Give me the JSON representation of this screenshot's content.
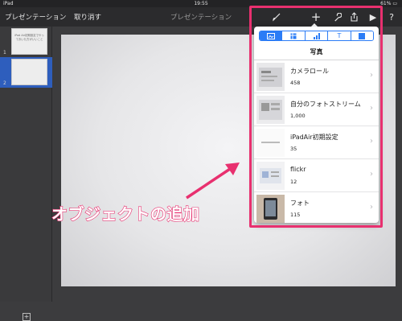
{
  "status_bar": {
    "carrier": "iPad",
    "time": "19:55",
    "battery": "61%"
  },
  "nav": {
    "presentations": "プレゼンテーション",
    "undo": "取り消す",
    "title": "プレゼンテーション"
  },
  "toolbar_icons": [
    "paintbrush-icon",
    "plus-icon",
    "wrench-icon",
    "share-icon",
    "play-icon",
    "help-icon"
  ],
  "slides": [
    {
      "number": "1",
      "text": "iPad Air初期設定でやっておいた方がいいこと"
    },
    {
      "number": "2",
      "text": ""
    }
  ],
  "popover": {
    "tabs": [
      "media",
      "table",
      "chart",
      "text",
      "shape"
    ],
    "active_tab": "media",
    "title": "写真",
    "albums": [
      {
        "name": "カメラロール",
        "count": "458"
      },
      {
        "name": "自分のフォトストリーム",
        "count": "1,000"
      },
      {
        "name": "iPadAir初期設定",
        "count": "35"
      },
      {
        "name": "flickr",
        "count": "12"
      },
      {
        "name": "フォト",
        "count": "115"
      }
    ]
  },
  "annotation": {
    "text": "オブジェクトの追加",
    "color": "#e8306f"
  },
  "colors": {
    "accent": "#2b7cf6",
    "highlight": "#e8306f",
    "selected_slide": "#2e5ebd"
  }
}
